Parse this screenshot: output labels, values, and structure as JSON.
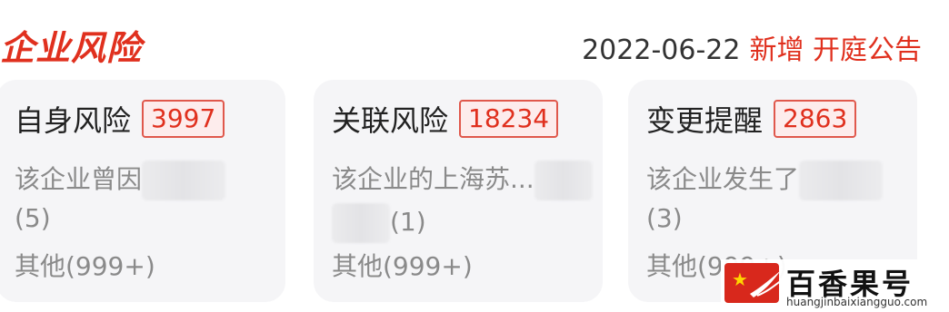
{
  "header": {
    "title": "企业风险",
    "notice_date": "2022-06-22",
    "notice_text": "新增 开庭公告"
  },
  "cards": [
    {
      "title": "自身风险",
      "count": "3997",
      "line1": "该企业曾因",
      "line2": "(5)",
      "line3": "其他(999+)"
    },
    {
      "title": "关联风险",
      "count": "18234",
      "line1": "该企业的上海苏...",
      "line2": "(1)",
      "line3": "其他(999+)"
    },
    {
      "title": "变更提醒",
      "count": "2863",
      "line1": "该企业发生了",
      "line2": "(3)",
      "line3": "其他(999+)"
    }
  ],
  "watermark": {
    "name": "百香果号",
    "url": "huangjinbaixiangguo.com"
  },
  "colors": {
    "accent": "#e0301e",
    "card_bg": "#f5f5f7",
    "muted_text": "#8a8a8a"
  }
}
